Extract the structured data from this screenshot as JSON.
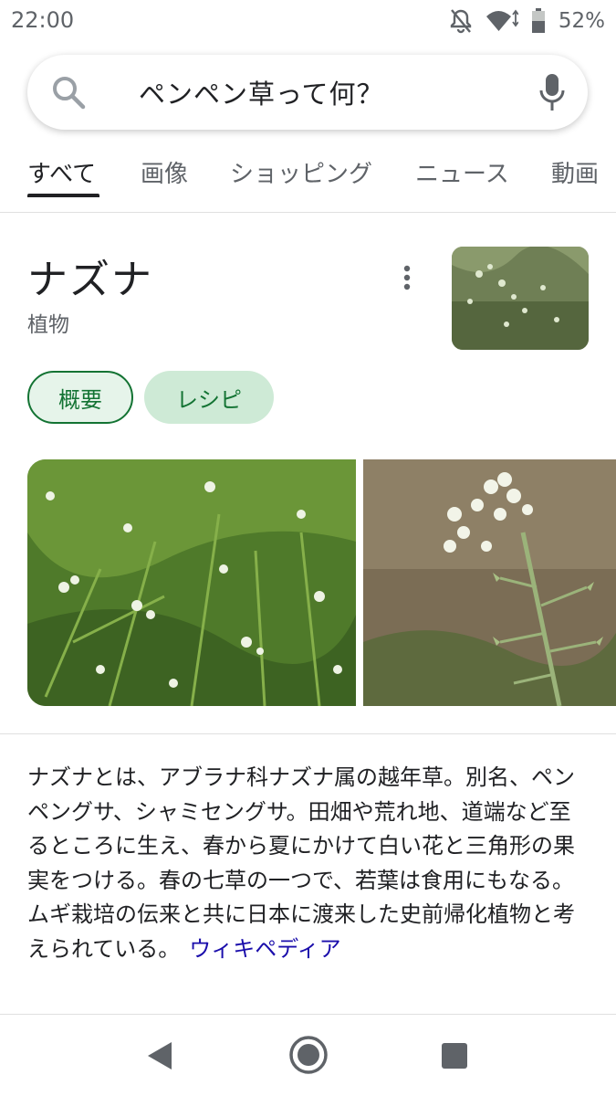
{
  "status_bar": {
    "time": "22:00",
    "battery": "52%",
    "icons": [
      "notifications-off-icon",
      "wifi-icon",
      "battery-icon"
    ]
  },
  "search": {
    "query": "ペンペン草って何？",
    "icons": [
      "search-icon",
      "mic-icon"
    ]
  },
  "tabs": [
    {
      "label": "すべて",
      "active": true
    },
    {
      "label": "画像",
      "active": false
    },
    {
      "label": "ショッピング",
      "active": false
    },
    {
      "label": "ニュース",
      "active": false
    },
    {
      "label": "動画",
      "active": false
    }
  ],
  "knowledge_panel": {
    "title": "ナズナ",
    "subtitle": "植物",
    "chips": [
      {
        "label": "概要",
        "selected": true
      },
      {
        "label": "レシピ",
        "selected": false
      }
    ],
    "description": "ナズナとは、アブラナ科ナズナ属の越年草。別名、ペンペングサ、シャミセングサ。田畑や荒れ地、道端など至るところに生え、春から夏にかけて白い花と三角形の果実をつける。春の七草の一つで、若葉は食用にもなる。ムギ栽培の伝来と共に日本に渡来した史前帰化植物と考えられている。",
    "source_link": "ウィキペディア"
  },
  "colors": {
    "accent_green": "#137333",
    "chip_bg": "#ceead6",
    "link_blue": "#1a0dab"
  },
  "nav_bar": {
    "icons": [
      "back-icon",
      "home-icon",
      "recents-icon"
    ]
  }
}
